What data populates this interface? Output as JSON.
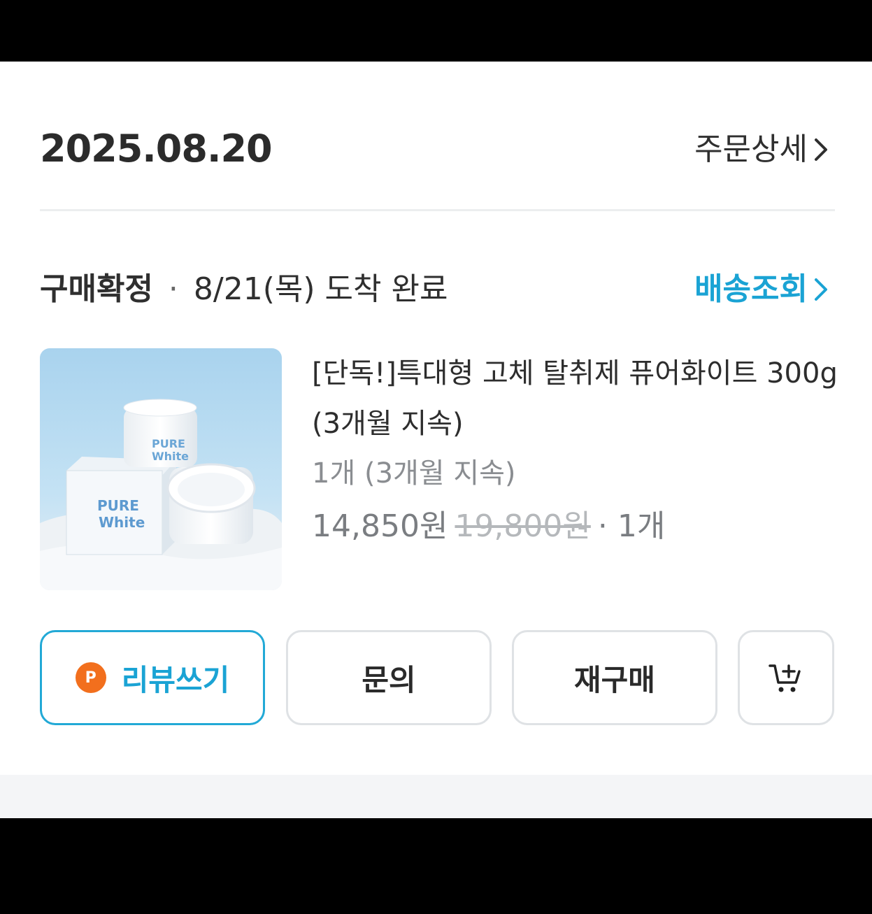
{
  "order": {
    "date": "2025.08.20",
    "detail_label": "주문상세"
  },
  "delivery": {
    "status": "구매확정",
    "separator": "·",
    "arrival": "8/21(목) 도착 완료",
    "track_label": "배송조회"
  },
  "product": {
    "name": "[단독!]특대형 고체 탈취제 퓨어화이트 300g (3개월 지속)",
    "option": "1개 (3개월 지속)",
    "price": "14,850원",
    "original_price": "19,800원",
    "quantity": "· 1개",
    "image": {
      "brand_line1": "PURE",
      "brand_line2": "White"
    }
  },
  "actions": {
    "review_badge": "P",
    "review_label": "리뷰쓰기",
    "inquiry_label": "문의",
    "rebuy_label": "재구매"
  },
  "colors": {
    "accent": "#1aa3d4",
    "badge": "#f26f1d",
    "text_primary": "#2d2d2d",
    "text_muted": "#8a8d91"
  },
  "icons": [
    "chevron-right-icon",
    "add-to-cart-icon",
    "point-badge-icon"
  ]
}
